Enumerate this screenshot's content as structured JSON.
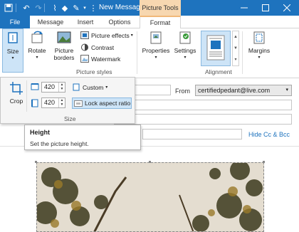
{
  "titlebar": {
    "title": "New Messag...",
    "context_tab": "Picture Tools",
    "minimize_icon": "minimize-icon",
    "maximize_icon": "maximize-icon",
    "close_icon": "close-icon"
  },
  "tabs": [
    {
      "label": "File"
    },
    {
      "label": "Message"
    },
    {
      "label": "Insert"
    },
    {
      "label": "Options"
    },
    {
      "label": "Format"
    }
  ],
  "ribbon": {
    "size": "Size",
    "rotate": "Rotate",
    "picture_borders_1": "Picture",
    "picture_borders_2": "borders",
    "picture_effects": "Picture effects",
    "contrast": "Contrast",
    "watermark": "Watermark",
    "picture_styles_group": "Picture styles",
    "properties": "Properties",
    "settings": "Settings",
    "alignment_group": "Alignment",
    "margins": "Margins"
  },
  "size_panel": {
    "crop": "Crop",
    "width_value": "420",
    "height_value": "420",
    "custom": "Custom",
    "lock_aspect": "Lock aspect ratio",
    "group_label": "Size"
  },
  "tooltip": {
    "title": "Height",
    "description": "Set the picture height."
  },
  "mail": {
    "from_label": "From",
    "from_value": "certifiedpedant@live.com",
    "hide_cc": "Hide Cc & Bcc"
  },
  "colors": {
    "accent": "#1e73be",
    "context_tab": "#f7d7b0",
    "selected_fill": "#cde4f7",
    "selected_border": "#8ab9e0"
  }
}
